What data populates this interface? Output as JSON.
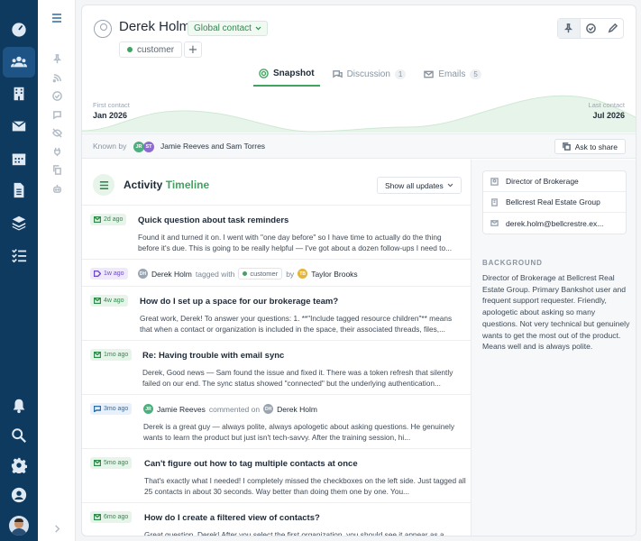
{
  "contact": {
    "name": "Derek Holm",
    "type_badge": "Global contact",
    "status_badge": "customer",
    "add_label": "+"
  },
  "tabs": [
    {
      "label": "Snapshot",
      "count": ""
    },
    {
      "label": "Discussion",
      "count": "1"
    },
    {
      "label": "Emails",
      "count": "5"
    }
  ],
  "timeline": {
    "first_label": "First contact",
    "first_value": "Jan 2026",
    "last_label": "Last contact",
    "last_value": "Jul 2026"
  },
  "known_by": {
    "label": "Known by",
    "avatars": [
      "JR",
      "ST"
    ],
    "names": "Jamie Reeves and Sam Torres",
    "ask_label": "Ask to share"
  },
  "activity": {
    "title_a": "Activity",
    "title_b": "Timeline",
    "filter_label": "Show all updates",
    "items": [
      {
        "kind": "email",
        "age": "2d ago",
        "title": "Quick question about task reminders",
        "body": "Found it and turned it on. I went with \"one day before\" so I have time to actually do the thing before it's due. This is going to be really helpful — I've got about a dozen follow-ups I need to..."
      },
      {
        "kind": "tag",
        "age": "1w ago",
        "actor_initials": "DH",
        "actor": "Derek Holm",
        "verb": "tagged with",
        "tag": "customer",
        "by": "by",
        "by_initials": "TB",
        "by_name": "Taylor Brooks"
      },
      {
        "kind": "email",
        "age": "4w ago",
        "title": "How do I set up a space for our brokerage team?",
        "body": "Great work, Derek! To answer your questions: 1. **\"Include tagged resource children\"** means that when a contact or organization is included in the space, their associated threads, files,..."
      },
      {
        "kind": "email",
        "age": "1mo ago",
        "title": "Re: Having trouble with email sync",
        "body": "Derek, Good news — Sam found the issue and fixed it. There was a token refresh that silently failed on our end. The sync status showed \"connected\" but the underlying authentication..."
      },
      {
        "kind": "comment",
        "age": "3mo ago",
        "actor_initials": "JR",
        "actor": "Jamie Reeves",
        "verb": "commented on",
        "target_initials": "DH",
        "target": "Derek Holm",
        "body": "Derek is a great guy — always polite, always apologetic about asking questions. He genuinely wants to learn the product but just isn't tech-savvy. After the training session, hi..."
      },
      {
        "kind": "email",
        "age": "5mo ago",
        "title": "Can't figure out how to tag multiple contacts at once",
        "body": "That's exactly what I needed! I completely missed the checkboxes on the left side. Just tagged all 25 contacts in about 30 seconds. Way better than doing them one by one. You..."
      },
      {
        "kind": "email",
        "age": "6mo ago",
        "title": "How do I create a filtered view of contacts?",
        "body": "Great question, Derek! After you select the first organization, you should see it appear as a"
      }
    ]
  },
  "details": {
    "role": "Director of Brokerage",
    "company": "Bellcrest Real Estate Group",
    "email": "derek.holm@bellcrestre.ex..."
  },
  "background": {
    "heading": "BACKGROUND",
    "text": "Director of Brokerage at Bellcrest Real Estate Group. Primary Bankshot user and frequent support requester. Friendly, apologetic about asking so many questions. Not very technical but genuinely wants to get the most out of the product. Means well and is always polite."
  },
  "colors": {
    "rail": "#0f3a5f",
    "accent_green": "#3fa45f",
    "tag_purple": "#6a4bbf",
    "comment_blue": "#2b6ca3",
    "avatar_jr": "#4caf7d",
    "avatar_st": "#8e6bd1",
    "avatar_dh": "#9aa5b1",
    "avatar_tb": "#e5b53a"
  }
}
